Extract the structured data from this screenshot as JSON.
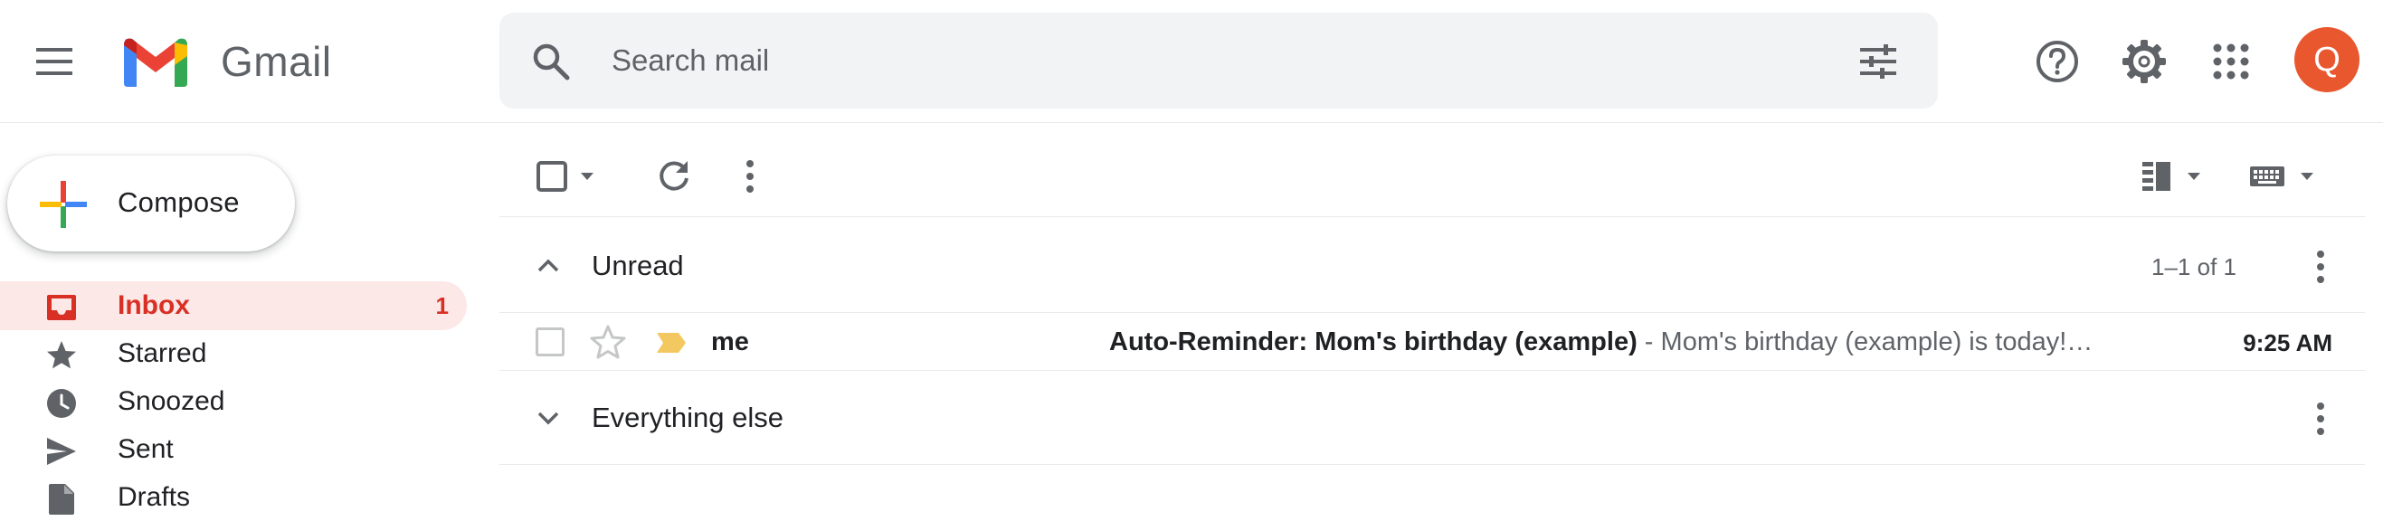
{
  "app": {
    "name": "Gmail"
  },
  "search": {
    "placeholder": "Search mail"
  },
  "user": {
    "initial": "Q",
    "avatar_color": "#e8572e"
  },
  "icons": {
    "menu": "menu-icon",
    "search": "search-icon",
    "tune": "tune-icon",
    "help": "help-icon",
    "settings": "gear-icon",
    "apps": "apps-grid-icon",
    "refresh": "refresh-icon",
    "more": "more-vert-icon",
    "split_pane": "split-pane-icon",
    "keyboard": "keyboard-icon"
  },
  "sidebar": {
    "compose_label": "Compose",
    "items": [
      {
        "label": "Inbox",
        "count": "1",
        "icon": "inbox-icon",
        "active": true
      },
      {
        "label": "Starred",
        "count": "",
        "icon": "star-icon",
        "active": false
      },
      {
        "label": "Snoozed",
        "count": "",
        "icon": "clock-icon",
        "active": false
      },
      {
        "label": "Sent",
        "count": "",
        "icon": "send-icon",
        "active": false
      },
      {
        "label": "Drafts",
        "count": "",
        "icon": "draft-icon",
        "active": false
      }
    ]
  },
  "sections": {
    "unread": {
      "title": "Unread",
      "range": "1–1 of 1",
      "expanded": true
    },
    "everything_else": {
      "title": "Everything else",
      "expanded": false
    }
  },
  "emails": [
    {
      "sender": "me",
      "subject": "Auto-Reminder: Mom's birthday (example)",
      "separator": " - ",
      "snippet": "Mom's birthday (example) is today!…",
      "time": "9:25 AM",
      "important": true,
      "starred": false
    }
  ],
  "colors": {
    "accent_red": "#d93025",
    "active_bg": "#fce8e6",
    "importance_marker": "#f4c860"
  }
}
